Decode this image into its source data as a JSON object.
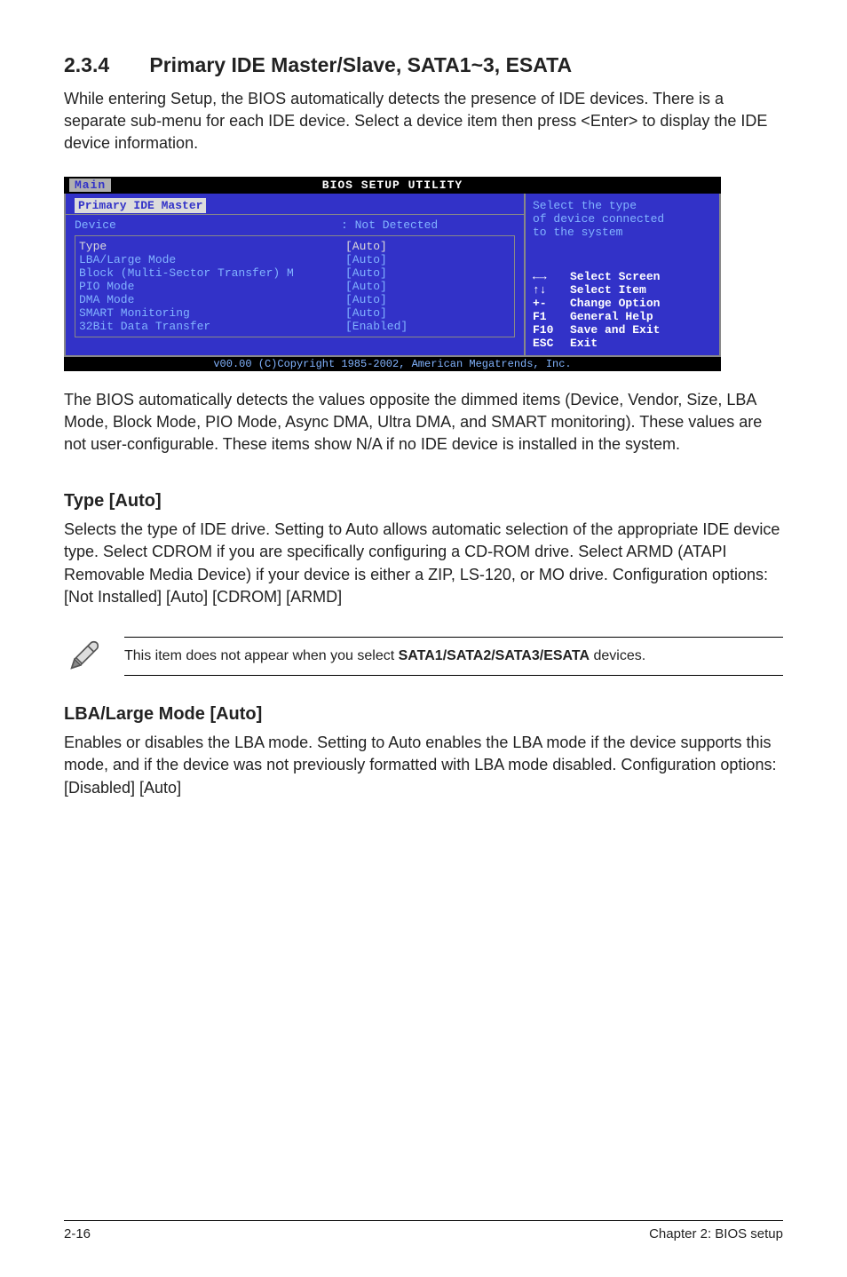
{
  "section": {
    "num": "2.3.4",
    "title": "Primary IDE Master/Slave, SATA1~3, ESATA"
  },
  "intro": "While entering Setup, the BIOS automatically detects the presence of IDE devices. There is a separate sub-menu for each IDE device. Select a device item then press <Enter> to display the IDE device information.",
  "bios": {
    "title": "BIOS SETUP UTILITY",
    "tab": "Main",
    "header": "Primary IDE Master",
    "device_label": "Device",
    "device_value": ": Not Detected",
    "rows": [
      {
        "label": "Type",
        "value": "[Auto]",
        "selected": true
      },
      {
        "label": "LBA/Large Mode",
        "value": "[Auto]"
      },
      {
        "label": "Block (Multi-Sector Transfer) M",
        "value": "[Auto]"
      },
      {
        "label": "PIO Mode",
        "value": "[Auto]"
      },
      {
        "label": "DMA Mode",
        "value": "[Auto]"
      },
      {
        "label": "SMART Monitoring",
        "value": "[Auto]"
      },
      {
        "label": "32Bit Data Transfer",
        "value": "[Enabled]"
      }
    ],
    "hint1": "Select the type",
    "hint2": "of device connected",
    "hint3": "to the system",
    "nav": [
      {
        "k": "←→",
        "d": "Select Screen"
      },
      {
        "k": "↑↓",
        "d": "Select Item"
      },
      {
        "k": "+-",
        "d": "Change Option"
      },
      {
        "k": "F1",
        "d": "General Help"
      },
      {
        "k": "F10",
        "d": "Save and Exit"
      },
      {
        "k": "ESC",
        "d": "Exit"
      }
    ],
    "copyright": "v00.00 (C)Copyright 1985-2002, American Megatrends, Inc."
  },
  "para1": "The BIOS automatically detects the values opposite the dimmed items (Device, Vendor, Size, LBA Mode, Block Mode, PIO Mode, Async DMA, Ultra DMA, and SMART monitoring). These values are not user-configurable. These items show N/A if no IDE device is installed in the system.",
  "type_h": "Type [Auto]",
  "type_p": "Selects the type of IDE drive. Setting to Auto allows automatic selection of the appropriate IDE device type. Select CDROM if you are specifically configuring a CD-ROM drive. Select ARMD (ATAPI Removable Media Device) if your device is either a ZIP, LS-120, or MO drive. Configuration options: [Not Installed] [Auto] [CDROM] [ARMD]",
  "note_pre": "This item does not appear when you select ",
  "note_bold": "SATA1/SATA2/SATA3/ESATA",
  "note_post": " devices.",
  "lba_h": "LBA/Large Mode [Auto]",
  "lba_p": "Enables or disables the LBA mode. Setting to Auto enables the LBA mode if the device supports this mode, and if the device was not previously formatted with LBA mode disabled. Configuration options: [Disabled] [Auto]",
  "footer": {
    "left": "2-16",
    "right": "Chapter 2: BIOS setup"
  }
}
